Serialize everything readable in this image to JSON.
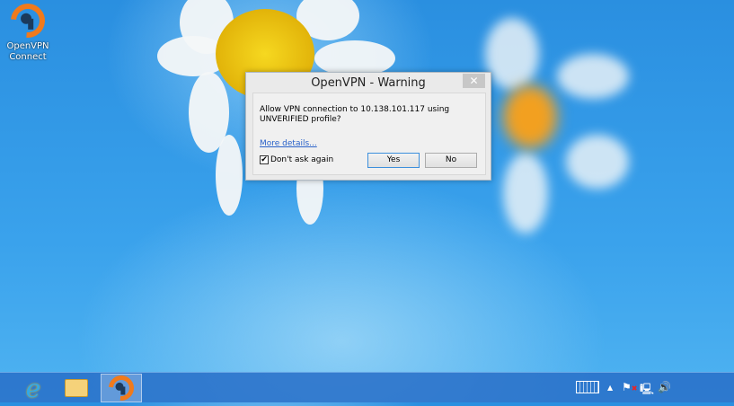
{
  "desktop": {
    "icons": [
      {
        "label": "OpenVPN Connect"
      }
    ]
  },
  "dialog": {
    "title": "OpenVPN - Warning",
    "close": "✕",
    "message": "Allow VPN connection to 10.138.101.117 using UNVERIFIED profile?",
    "link": "More details...",
    "checkbox_label": "Don't ask again",
    "checkbox_checked": true,
    "check_mark": "✔",
    "yes": "Yes",
    "no": "No"
  },
  "taskbar": {
    "items": [
      "Internet Explorer",
      "File Explorer",
      "OpenVPN Connect"
    ],
    "tray": [
      "keyboard-icon",
      "show-hidden-icons",
      "action-center-flag",
      "network-icon",
      "volume-icon"
    ],
    "tray_caret": "▲"
  }
}
